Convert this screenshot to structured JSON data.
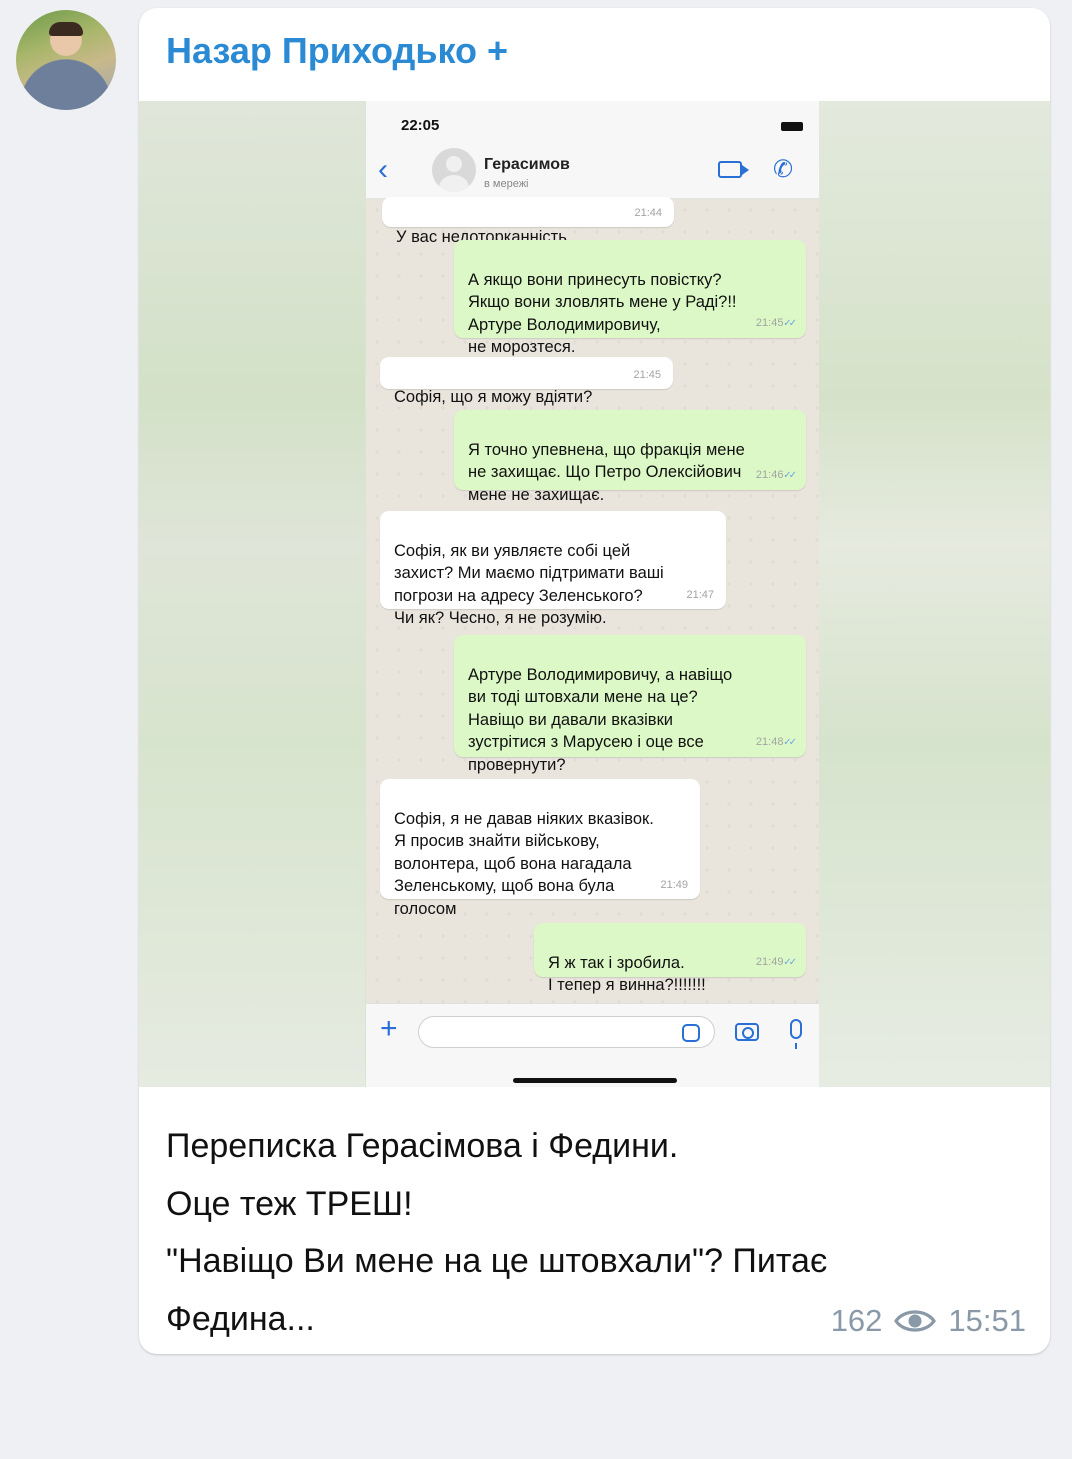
{
  "post": {
    "sender": "Назар Приходько +",
    "caption_lines": [
      "Переписка Герасімова і Федини.",
      "Оце теж ТРЕШ!",
      "\"Навіщо Ви мене на це штовхали\"? Питає",
      "Федина..."
    ],
    "views": "162",
    "time": "15:51"
  },
  "screenshot": {
    "status_time": "22:05",
    "contact_name": "Герасимов",
    "contact_status": "в мережі",
    "messages": [
      {
        "dir": "in",
        "text": "У вас недоторканність.",
        "time": "21:44"
      },
      {
        "dir": "out",
        "text": "А якщо вони принесуть повістку?\nЯкщо вони зловлять мене у Раді?!!\nАртуре Володимировичу,\nне морозтеся.",
        "time": "21:45"
      },
      {
        "dir": "in",
        "text": "Софія, що я можу вдіяти?",
        "time": "21:45"
      },
      {
        "dir": "out",
        "text": "Я точно упевнена, що фракція мене\nне захищає. Що Петро Олексійович\nмене  не захищає.",
        "time": "21:46"
      },
      {
        "dir": "in",
        "text": "Софія, як ви уявляєте собі цей\nзахист? Ми маємо підтримати ваші\nпогрози на адресу Зеленського?\nЧи як? Чесно, я не розумію.",
        "time": "21:47"
      },
      {
        "dir": "out",
        "text": "Артуре Володимировичу, а навіщо\nви тоді штовхали мене на це?\nНавіщо ви давали вказівки\nзустрітися з Марусею і оце все\nпровернути?",
        "time": "21:48"
      },
      {
        "dir": "in",
        "text": "Софія, я не давав ніяких вказівок.\nЯ просив знайти військову,\nволонтера, щоб вона нагадала\nЗеленському, щоб вона була\nголосом",
        "time": "21:49"
      },
      {
        "dir": "out",
        "text": "Я ж так і зробила.\nІ тепер я винна?!!!!!!!",
        "time": "21:49"
      }
    ]
  },
  "colors": {
    "sender_name": "#2a8ad4",
    "outgoing_bubble": "#dcf8c6",
    "incoming_bubble": "#ffffff",
    "accent": "#2a6fd6",
    "meta_text": "#8a99a8"
  },
  "icons": [
    "avatar",
    "back-chevron-icon",
    "video-call-icon",
    "phone-call-icon",
    "plus-icon",
    "sticker-icon",
    "camera-icon",
    "microphone-icon",
    "eye-icon"
  ]
}
